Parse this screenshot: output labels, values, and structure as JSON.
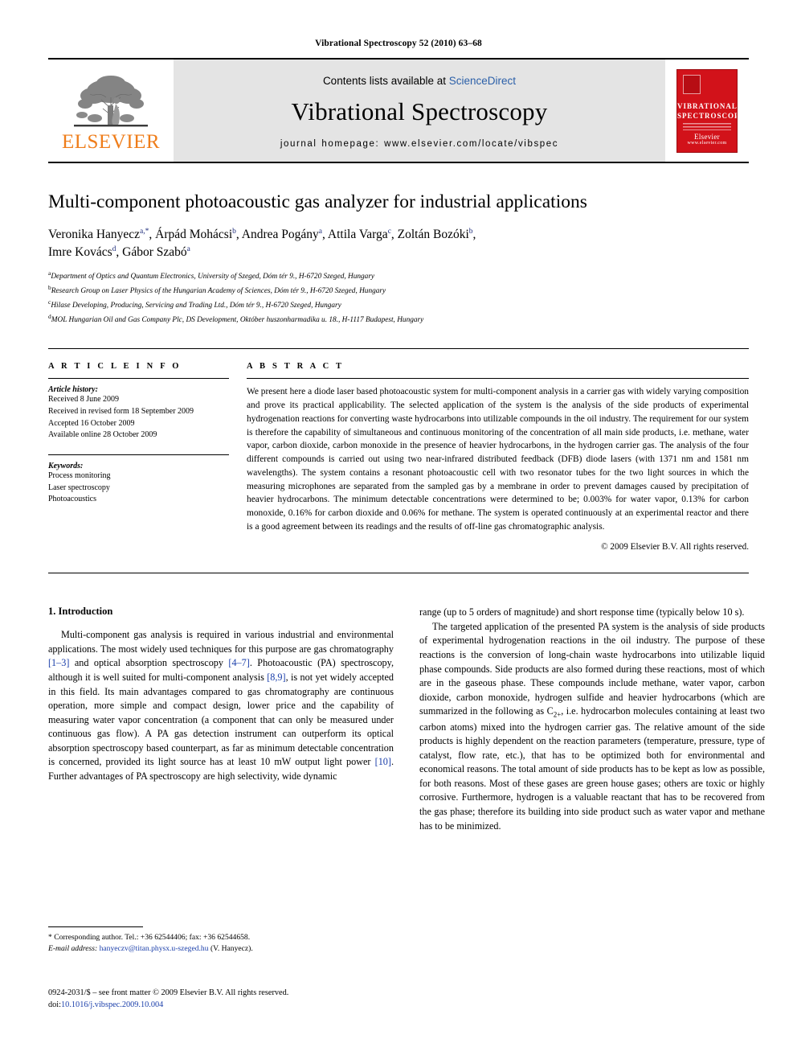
{
  "running_head": "Vibrational Spectroscopy 52 (2010) 63–68",
  "masthead": {
    "contents_prefix": "Contents lists available at ",
    "sciencedirect": "ScienceDirect",
    "journal_name": "Vibrational Spectroscopy",
    "homepage": "journal homepage: www.elsevier.com/locate/vibspec",
    "publisher_logo_text": "ELSEVIER",
    "cover": {
      "line1": "VIBRATIONAL",
      "line2": "SPECTROSCOPY",
      "footer_big": "Elsevier",
      "footer_small": "www.elsevier.com"
    },
    "colors": {
      "band_background": "#e4e4e4",
      "elsevier_orange": "#ef7d1a",
      "link_blue": "#2b5fa8",
      "cover_red": "#d2121a"
    }
  },
  "article": {
    "title": "Multi-component photoacoustic gas analyzer for industrial applications",
    "authors_line1": "Veronika Hanyecz",
    "authors": [
      {
        "name": "Veronika Hanyecz",
        "marks": "a,*"
      },
      {
        "name": "Árpád Mohácsi",
        "marks": "b"
      },
      {
        "name": "Andrea Pogány",
        "marks": "a"
      },
      {
        "name": "Attila Varga",
        "marks": "c"
      },
      {
        "name": "Zoltán Bozóki",
        "marks": "b"
      },
      {
        "name": "Imre Kovács",
        "marks": "d"
      },
      {
        "name": "Gábor Szabó",
        "marks": "a"
      }
    ],
    "affiliations": [
      {
        "mark": "a",
        "text": "Department of Optics and Quantum Electronics, University of Szeged, Dóm tér 9., H-6720 Szeged, Hungary"
      },
      {
        "mark": "b",
        "text": "Research Group on Laser Physics of the Hungarian Academy of Sciences, Dóm tér 9., H-6720 Szeged, Hungary"
      },
      {
        "mark": "c",
        "text": "Hilase Developing, Producing, Servicing and Trading Ltd., Dóm tér 9., H-6720 Szeged, Hungary"
      },
      {
        "mark": "d",
        "text": "MOL Hungarian Oil and Gas Company Plc, DS Development, Október huszonharmadika u. 18., H-1117 Budapest, Hungary"
      }
    ]
  },
  "article_info": {
    "heading": "A R T I C L E   I N F O",
    "history_label": "Article history:",
    "history": [
      "Received 8 June 2009",
      "Received in revised form 18 September 2009",
      "Accepted 16 October 2009",
      "Available online 28 October 2009"
    ],
    "keywords_label": "Keywords:",
    "keywords": [
      "Process monitoring",
      "Laser spectroscopy",
      "Photoacoustics"
    ]
  },
  "abstract": {
    "heading": "A B S T R A C T",
    "text": "We present here a diode laser based photoacoustic system for multi-component analysis in a carrier gas with widely varying composition and prove its practical applicability. The selected application of the system is the analysis of the side products of experimental hydrogenation reactions for converting waste hydrocarbons into utilizable compounds in the oil industry. The requirement for our system is therefore the capability of simultaneous and continuous monitoring of the concentration of all main side products, i.e. methane, water vapor, carbon dioxide, carbon monoxide in the presence of heavier hydrocarbons, in the hydrogen carrier gas. The analysis of the four different compounds is carried out using two near-infrared distributed feedback (DFB) diode lasers (with 1371 nm and 1581 nm wavelengths). The system contains a resonant photoacoustic cell with two resonator tubes for the two light sources in which the measuring microphones are separated from the sampled gas by a membrane in order to prevent damages caused by precipitation of heavier hydrocarbons. The minimum detectable concentrations were determined to be; 0.003% for water vapor, 0.13% for carbon monoxide, 0.16% for carbon dioxide and 0.06% for methane. The system is operated continuously at an experimental reactor and there is a good agreement between its readings and the results of off-line gas chromatographic analysis.",
    "copyright": "© 2009 Elsevier B.V. All rights reserved."
  },
  "body": {
    "section_title": "1. Introduction",
    "left_para_1_a": "Multi-component gas analysis is required in various industrial and environmental applications. The most widely used techniques for this purpose are gas chromatography ",
    "cite_1_3": "[1–3]",
    "left_para_1_b": " and optical absorption spectroscopy ",
    "cite_4_7": "[4–7]",
    "left_para_1_c": ". Photoacoustic (PA) spectroscopy, although it is well suited for multi-component analysis ",
    "cite_8_9": "[8,9]",
    "left_para_1_d": ", is not yet widely accepted in this field. Its main advantages compared to gas chromatography are continuous operation, more simple and compact design, lower price and the capability of measuring water vapor concentration (a component that can only be measured under continuous gas flow). A PA gas detection instrument can outperform its optical absorption spectroscopy based counterpart, as far as minimum detectable concentration is concerned, provided its light source has at least 10 mW output light power ",
    "cite_10": "[10]",
    "left_para_1_e": ". Further advantages of PA spectroscopy are high selectivity, wide dynamic",
    "right_para_continuation": "range (up to 5 orders of magnitude) and short response time (typically below 10 s).",
    "right_para_2_a": "The targeted application of the presented PA system is the analysis of side products of experimental hydrogenation reactions in the oil industry. The purpose of these reactions is the conversion of long-chain waste hydrocarbons into utilizable liquid phase compounds. Side products are also formed during these reactions, most of which are in the gaseous phase. These compounds include methane, water vapor, carbon dioxide, carbon monoxide, hydrogen sulfide and heavier hydrocarbons (which are summarized in the following as C",
    "c2plus_sub": "2+",
    "right_para_2_b": ", i.e. hydrocarbon molecules containing at least two carbon atoms) mixed into the hydrogen carrier gas. The relative amount of the side products is highly dependent on the reaction parameters (temperature, pressure, type of catalyst, flow rate, etc.), that has to be optimized both for environmental and economical reasons. The total amount of side products has to be kept as low as possible, for both reasons. Most of these gases are green house gases; others are toxic or highly corrosive. Furthermore, hydrogen is a valuable reactant that has to be recovered from the gas phase; therefore its building into side product such as water vapor and methane has to be minimized."
  },
  "footnotes": {
    "corresponding": "* Corresponding author. Tel.: +36 62544406; fax: +36 62544658.",
    "email_label": "E-mail address:",
    "email": "hanyeczv@titan.physx.u-szeged.hu",
    "email_suffix": "(V. Hanyecz).",
    "issn_line": "0924-2031/$ – see front matter © 2009 Elsevier B.V. All rights reserved.",
    "doi_label": "doi:",
    "doi": "10.1016/j.vibspec.2009.10.004"
  }
}
